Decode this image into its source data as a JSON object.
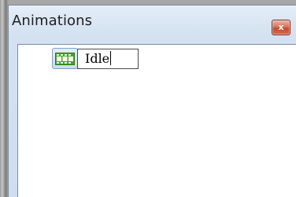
{
  "window": {
    "title": "Animations",
    "close_icon": "close-icon",
    "close_glyph": "x"
  },
  "tree": {
    "items": [
      {
        "icon": "film-strip-icon",
        "label": "Idle",
        "editing": true
      }
    ]
  },
  "colors": {
    "title_bar": "#dbe7f4",
    "close_button": "#d9684a",
    "icon_green": "#4aa52a",
    "selection_blue": "#c9dcf0"
  }
}
